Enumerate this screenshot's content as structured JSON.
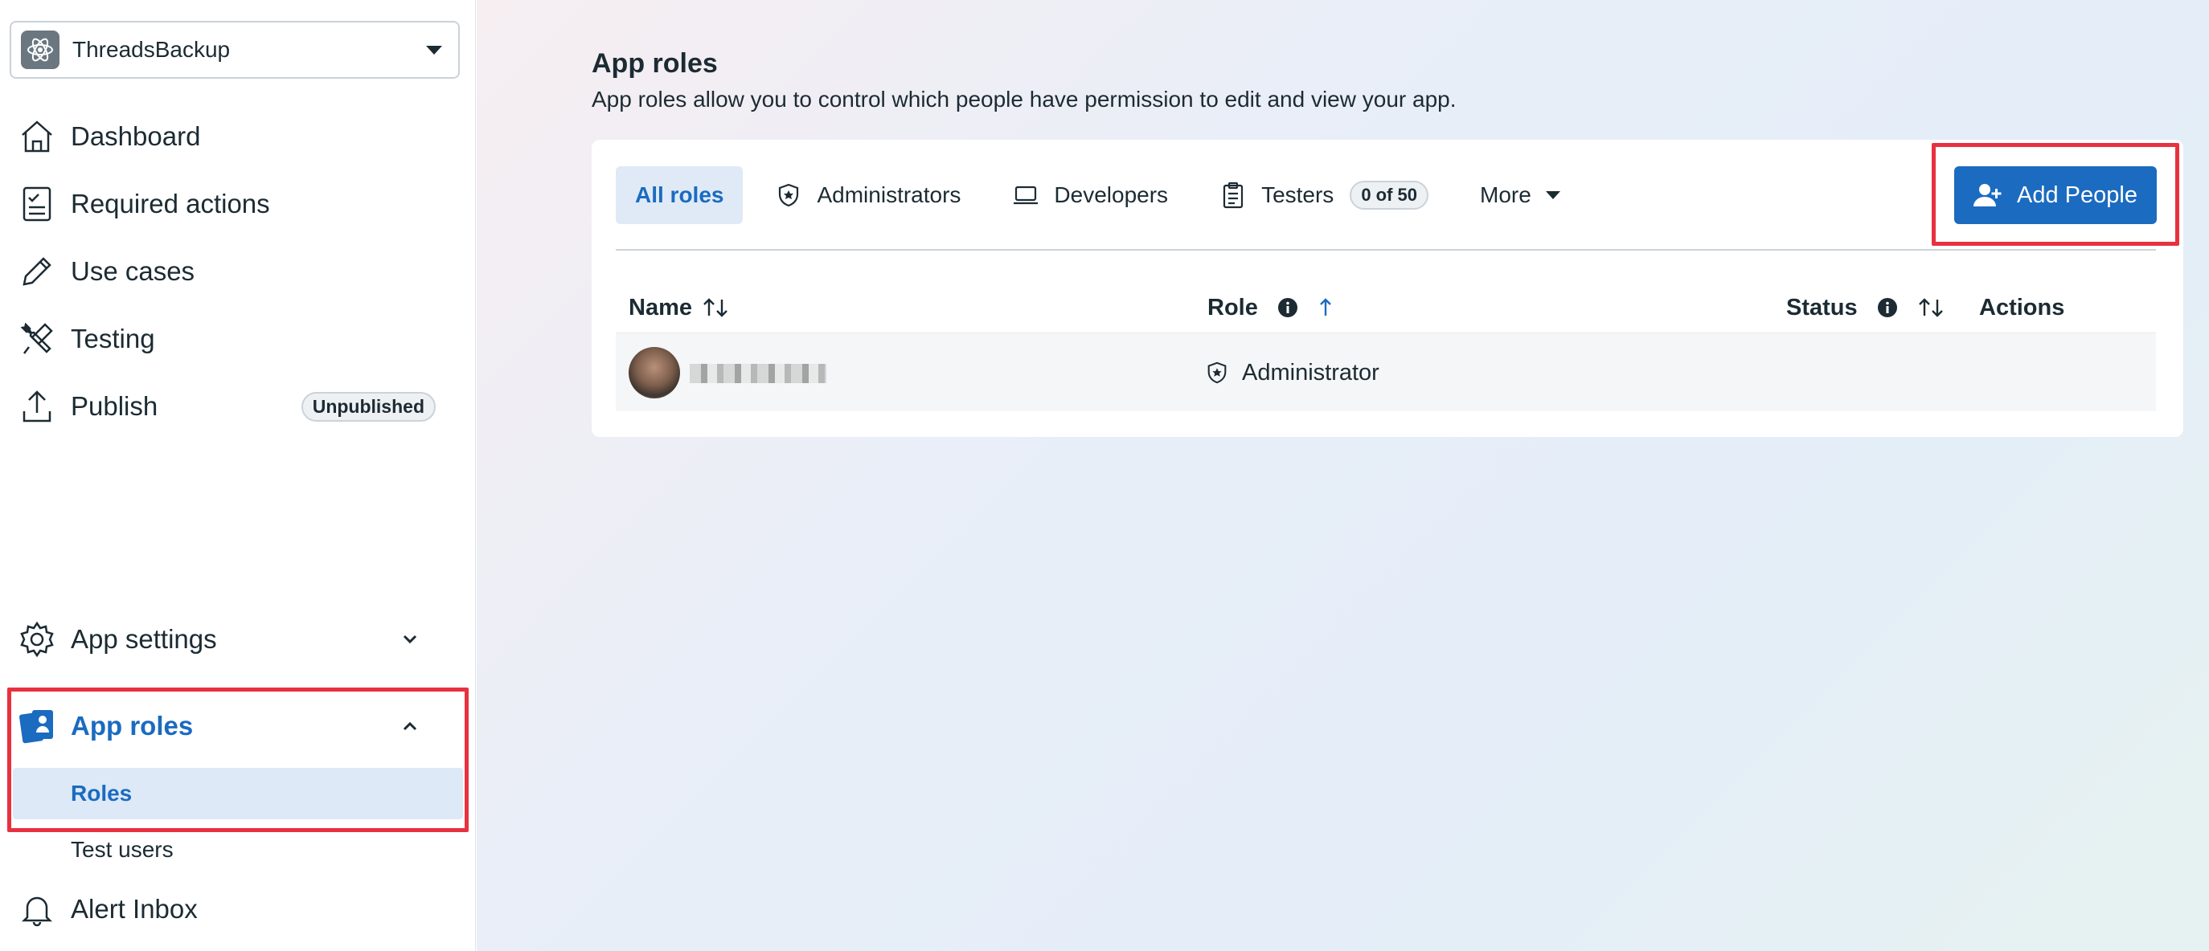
{
  "app": {
    "name": "ThreadsBackup"
  },
  "sidebar": {
    "items": [
      {
        "label": "Dashboard",
        "icon": "home-icon"
      },
      {
        "label": "Required actions",
        "icon": "checklist-icon"
      },
      {
        "label": "Use cases",
        "icon": "pencil-icon"
      },
      {
        "label": "Testing",
        "icon": "tools-icon"
      },
      {
        "label": "Publish",
        "icon": "upload-icon",
        "badge": "Unpublished"
      },
      {
        "label": "App settings",
        "icon": "gear-icon"
      },
      {
        "label": "App roles",
        "icon": "app-roles-icon",
        "active": true
      },
      {
        "label": "Alert Inbox",
        "icon": "bell-icon"
      }
    ],
    "sub_items": [
      {
        "label": "Roles",
        "active": true
      },
      {
        "label": "Test users"
      }
    ]
  },
  "main": {
    "title": "App roles",
    "description": "App roles allow you to control which people have permission to edit and view your app.",
    "tabs": [
      {
        "label": "All roles",
        "active": true
      },
      {
        "label": "Administrators",
        "icon": "shield-star-icon"
      },
      {
        "label": "Developers",
        "icon": "laptop-icon"
      },
      {
        "label": "Testers",
        "icon": "clipboard-icon",
        "count": "0 of 50"
      },
      {
        "label": "More"
      }
    ],
    "add_button": "Add People",
    "table": {
      "columns": [
        "Name",
        "Role",
        "Status",
        "Actions"
      ],
      "rows": [
        {
          "name": "",
          "role": "Administrator",
          "status": ""
        }
      ]
    }
  },
  "colors": {
    "accent": "#1b6bc0",
    "highlight": "#e8313f",
    "active_bg": "#dfeaf6"
  }
}
